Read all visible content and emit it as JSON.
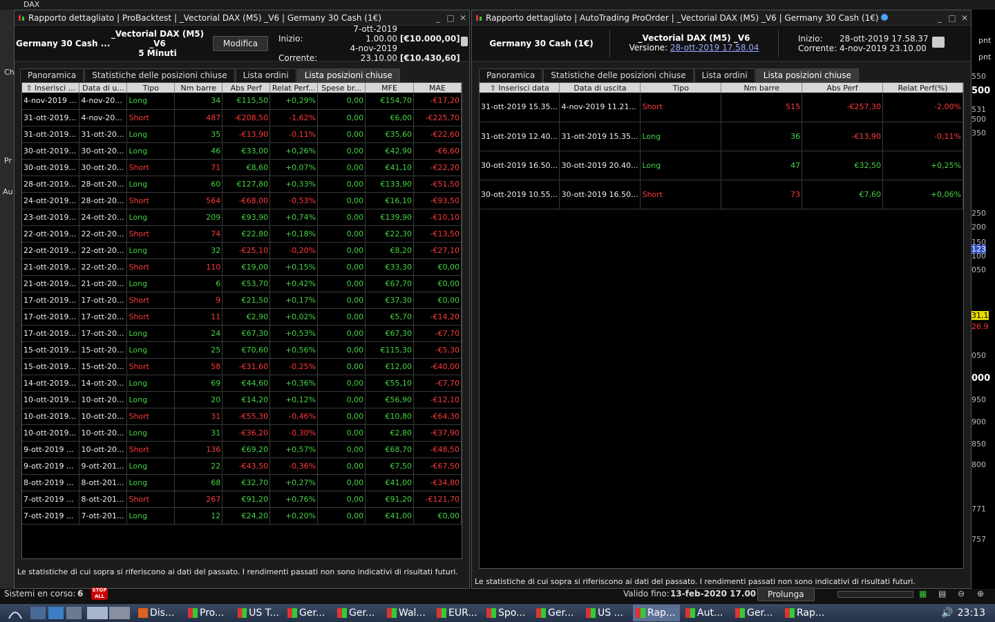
{
  "background": {
    "top_left_label": "DAX",
    "left_fragments": [
      "Ch",
      "Pr",
      "Au"
    ],
    "right_labels": [
      "pnt",
      "pnt"
    ],
    "right_ticks": [
      "550",
      "500",
      "531",
      "500",
      "350",
      "250",
      "200",
      "150",
      "123",
      "100",
      "050",
      "31,1",
      "26,9",
      "050",
      "000",
      "950",
      "900",
      "850",
      "800",
      "771",
      "757"
    ]
  },
  "left_window": {
    "title": "Rapporto dettagliato | ProBacktest | _Vectorial DAX (M5) _V6 | Germany 30 Cash (1€)",
    "instrument": "Germany 30 Cash ...",
    "strategy_line1": "_Vectorial DAX (M5) _V6",
    "strategy_line2": "5 Minuti",
    "modify_label": "Modifica",
    "start_label": "Inizio:",
    "start_value": "7-ott-2019 1.00.00",
    "start_amount": "[€10.000,00]",
    "current_label": "Corrente:",
    "current_value": "4-nov-2019 23.10.00",
    "current_amount": "[€10.430,60]",
    "tabs": [
      "Panoramica",
      "Statistiche delle posizioni chiuse",
      "Lista ordini",
      "Lista posizioni chiuse"
    ],
    "columns": [
      "⇧ Inserisci ...",
      "Data di u...",
      "Tipo",
      "Nm barre",
      "Abs Perf",
      "Relat Perf...",
      "Spese br...",
      "MFE",
      "MAE"
    ],
    "rows": [
      [
        "4-nov-2019 ...",
        "4-nov-20...",
        "Long",
        "34",
        "€115,50",
        "+0,29%",
        "0,00",
        "€154,70",
        "-€17,20"
      ],
      [
        "31-ott-2019...",
        "4-nov-20...",
        "Short",
        "487",
        "-€208,50",
        "-1,62%",
        "0,00",
        "€6,00",
        "-€225,70"
      ],
      [
        "31-ott-2019...",
        "31-ott-20...",
        "Long",
        "35",
        "-€13,90",
        "-0,11%",
        "0,00",
        "€35,60",
        "-€22,60"
      ],
      [
        "30-ott-2019...",
        "30-ott-20...",
        "Long",
        "46",
        "€33,00",
        "+0,26%",
        "0,00",
        "€42,90",
        "-€6,60"
      ],
      [
        "30-ott-2019...",
        "30-ott-20...",
        "Short",
        "71",
        "€8,60",
        "+0,07%",
        "0,00",
        "€41,10",
        "-€22,20"
      ],
      [
        "28-ott-2019...",
        "28-ott-20...",
        "Long",
        "60",
        "€127,80",
        "+0,33%",
        "0,00",
        "€133,90",
        "-€51,50"
      ],
      [
        "24-ott-2019...",
        "28-ott-20...",
        "Short",
        "564",
        "-€68,00",
        "-0,53%",
        "0,00",
        "€16,10",
        "-€93,50"
      ],
      [
        "23-ott-2019...",
        "24-ott-20...",
        "Long",
        "209",
        "€93,90",
        "+0,74%",
        "0,00",
        "€139,90",
        "-€10,10"
      ],
      [
        "22-ott-2019...",
        "22-ott-20...",
        "Short",
        "74",
        "€22,80",
        "+0,18%",
        "0,00",
        "€22,30",
        "-€13,50"
      ],
      [
        "22-ott-2019...",
        "22-ott-20...",
        "Long",
        "32",
        "-€25,10",
        "-0,20%",
        "0,00",
        "€8,20",
        "-€27,10"
      ],
      [
        "21-ott-2019...",
        "22-ott-20...",
        "Short",
        "110",
        "€19,00",
        "+0,15%",
        "0,00",
        "€33,30",
        "€0,00"
      ],
      [
        "21-ott-2019...",
        "21-ott-20...",
        "Long",
        "6",
        "€53,70",
        "+0,42%",
        "0,00",
        "€67,70",
        "€0,00"
      ],
      [
        "17-ott-2019...",
        "17-ott-20...",
        "Short",
        "9",
        "€21,50",
        "+0,17%",
        "0,00",
        "€37,30",
        "€0,00"
      ],
      [
        "17-ott-2019...",
        "17-ott-20...",
        "Short",
        "11",
        "€2,90",
        "+0,02%",
        "0,00",
        "€5,70",
        "-€14,20"
      ],
      [
        "17-ott-2019...",
        "17-ott-20...",
        "Long",
        "24",
        "€67,30",
        "+0,53%",
        "0,00",
        "€67,30",
        "-€7,70"
      ],
      [
        "15-ott-2019...",
        "15-ott-20...",
        "Long",
        "25",
        "€70,60",
        "+0,56%",
        "0,00",
        "€115,30",
        "-€5,30"
      ],
      [
        "15-ott-2019...",
        "15-ott-20...",
        "Short",
        "58",
        "-€31,60",
        "-0,25%",
        "0,00",
        "€12,00",
        "-€40,00"
      ],
      [
        "14-ott-2019...",
        "14-ott-20...",
        "Long",
        "69",
        "€44,60",
        "+0,36%",
        "0,00",
        "€55,10",
        "-€7,70"
      ],
      [
        "10-ott-2019...",
        "10-ott-20...",
        "Long",
        "20",
        "€14,20",
        "+0,12%",
        "0,00",
        "€56,90",
        "-€12,10"
      ],
      [
        "10-ott-2019...",
        "10-ott-20...",
        "Short",
        "31",
        "-€55,30",
        "-0,46%",
        "0,00",
        "€10,80",
        "-€64,30"
      ],
      [
        "10-ott-2019...",
        "10-ott-20...",
        "Long",
        "31",
        "-€36,20",
        "-0,30%",
        "0,00",
        "€2,80",
        "-€37,90"
      ],
      [
        "9-ott-2019 ...",
        "10-ott-20...",
        "Short",
        "136",
        "€69,20",
        "+0,57%",
        "0,00",
        "€68,70",
        "-€48,50"
      ],
      [
        "9-ott-2019 ...",
        "9-ott-201...",
        "Long",
        "22",
        "-€43,50",
        "-0,36%",
        "0,00",
        "€7,50",
        "-€67,50"
      ],
      [
        "8-ott-2019 ...",
        "8-ott-201...",
        "Long",
        "68",
        "€32,70",
        "+0,27%",
        "0,00",
        "€41,00",
        "-€34,80"
      ],
      [
        "7-ott-2019 ...",
        "8-ott-201...",
        "Short",
        "267",
        "€91,20",
        "+0,76%",
        "0,00",
        "€91,20",
        "-€121,70"
      ],
      [
        "7-ott-2019 ...",
        "7-ott-201...",
        "Long",
        "12",
        "€24,20",
        "+0,20%",
        "0,00",
        "€41,00",
        "€0,00"
      ]
    ],
    "footnote": "Le statistiche di cui sopra si riferiscono ai dati del passato. I rendimenti passati non sono indicativi di risultati futuri."
  },
  "right_window": {
    "title": "Rapporto dettagliato | AutoTrading ProOrder | _Vectorial DAX (M5) _V6 | Germany 30 Cash (1€)",
    "instrument": "Germany 30 Cash (1€)",
    "strategy_line1": "_Vectorial DAX (M5) _V6",
    "version_label": "Versione:",
    "version_value": "28-ott-2019 17.58.04",
    "start_label": "Inizio:",
    "start_value": "28-ott-2019 17.58.37",
    "current_label": "Corrente:",
    "current_value": "4-nov-2019 23.10.00",
    "tabs": [
      "Panoramica",
      "Statistiche delle posizioni chiuse",
      "Lista ordini",
      "Lista posizioni chiuse"
    ],
    "columns": [
      "⇧ Inserisci data",
      "Data di uscita",
      "Tipo",
      "Nm barre",
      "Abs Perf",
      "Relat Perf(%)"
    ],
    "rows": [
      [
        "31-ott-2019 15.35...",
        "4-nov-2019 11.21...",
        "Short",
        "515",
        "-€257,30",
        "-2,00%"
      ],
      [
        "31-ott-2019 12.40...",
        "31-ott-2019 15.35...",
        "Long",
        "36",
        "-€13,90",
        "-0,11%"
      ],
      [
        "30-ott-2019 16.50...",
        "30-ott-2019 20.40...",
        "Long",
        "47",
        "€32,50",
        "+0,25%"
      ],
      [
        "30-ott-2019 10.55...",
        "30-ott-2019 16.50...",
        "Short",
        "73",
        "€7,60",
        "+0,06%"
      ]
    ],
    "footnote": "Le statistiche di cui sopra si riferiscono ai dati del passato. I rendimenti passati non sono indicativi di risultati futuri."
  },
  "statusbar": {
    "systems_label": "Sistemi en corso:",
    "systems_count": "6",
    "stop_label": "STOP ALL",
    "valid_label": "Valido fino:",
    "valid_value": "13-feb-2020 17.00",
    "extend_label": "Prolunga"
  },
  "taskbar": {
    "items": [
      "Dis...",
      "Pro...",
      "US T...",
      "Ger...",
      "Ger...",
      "Wal...",
      "EUR...",
      "Spo...",
      "Ger...",
      "US ...",
      "Rap...",
      "Aut...",
      "Ger...",
      "Rap..."
    ],
    "clock": "23:13"
  },
  "colors": {
    "profit": "#45d445",
    "loss": "#ff3b3b",
    "header_bg": "#d8d8d8",
    "taskbar": "#2e3d57"
  }
}
